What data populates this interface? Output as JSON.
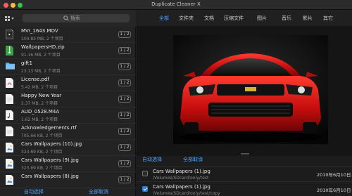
{
  "window": {
    "title": "Duplicate Cleaner X"
  },
  "search": {
    "placeholder": "搜索"
  },
  "sidebar": {
    "files": [
      {
        "name": "MVI_1643.MOV",
        "meta": "104.83 MB, 2 个项目",
        "badge": "1 / 2",
        "icon": "video-file-icon"
      },
      {
        "name": "WallpapersHD.zip",
        "meta": "91.16 MB, 2 个项目",
        "badge": "1 / 2",
        "icon": "zip-file-icon"
      },
      {
        "name": "gift1",
        "meta": "23.13 MB, 2 个项目",
        "badge": "1 / 2",
        "icon": "folder-icon"
      },
      {
        "name": "License.pdf",
        "meta": "5.42 MB, 2 个项目",
        "badge": "1 / 2",
        "icon": "pdf-file-icon"
      },
      {
        "name": "Happy New Year",
        "meta": "2.37 MB, 2 个项目",
        "badge": "1 / 2",
        "icon": "document-file-icon"
      },
      {
        "name": "AUD_0528.M4A",
        "meta": "1.62 MB, 2 个项目",
        "badge": "1 / 2",
        "icon": "audio-file-icon"
      },
      {
        "name": "Acknowledgements.rtf",
        "meta": "705.66 KB, 2 个项目",
        "badge": "1 / 2",
        "icon": "document-file-icon"
      },
      {
        "name": "Cars Wallpapers (10).jpg",
        "meta": "323.69 KB, 2 个项目",
        "badge": "1 / 2",
        "icon": "image-file-icon"
      },
      {
        "name": "Cars Wallpapers (9).jpg",
        "meta": "323.69 KB, 2 个项目",
        "badge": "1 / 2",
        "icon": "image-file-icon"
      },
      {
        "name": "Cars Wallpapers (8).jpg",
        "meta": "",
        "badge": "1 / 2",
        "icon": "image-file-icon"
      }
    ],
    "auto_select": "自动选择",
    "deselect_all": "全部取消"
  },
  "tabs": [
    "全部",
    "文件夹",
    "文档",
    "压缩文件",
    "图片",
    "音乐",
    "影片",
    "其它"
  ],
  "actions": {
    "auto_select": "自动选择",
    "deselect_all": "全部取消"
  },
  "duplicates": [
    {
      "name": "Cars Wallpapers (1).jpg",
      "path": "/Volumes/SDcard/only/test",
      "date": "2010年6月10日",
      "checked": false
    },
    {
      "name": "Cars Wallpapers (1).jpg",
      "path": "/Volumes/SDcard/only/test/copy",
      "date": "2010年6月10日",
      "checked": true
    }
  ],
  "colors": {
    "accent": "#4da3ff",
    "car_red": "#d41414"
  }
}
